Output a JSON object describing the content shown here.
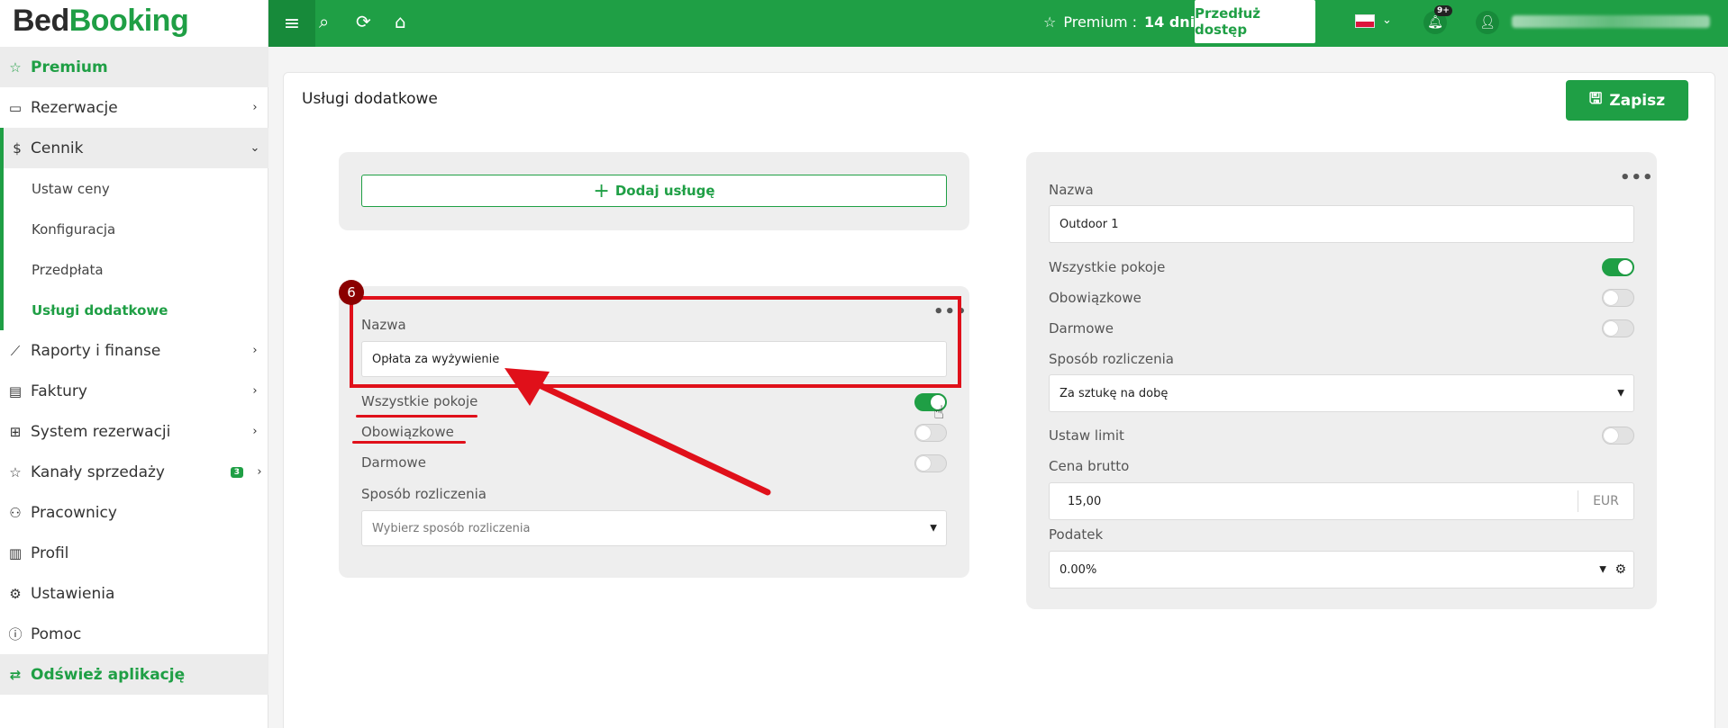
{
  "logo": {
    "part1": "Bed",
    "part2": "Booking"
  },
  "sidebar": {
    "premium": "Premium",
    "items": [
      {
        "label": "Rezerwacje"
      },
      {
        "label": "Cennik"
      },
      {
        "label": "Raporty i finanse"
      },
      {
        "label": "Faktury"
      },
      {
        "label": "System rezerwacji"
      },
      {
        "label": "Kanały sprzedaży",
        "badge": "3"
      },
      {
        "label": "Pracownicy"
      },
      {
        "label": "Profil"
      },
      {
        "label": "Ustawienia"
      },
      {
        "label": "Pomoc"
      }
    ],
    "sub": [
      "Ustaw ceny",
      "Konfiguracja",
      "Przedpłata",
      "Usługi dodatkowe"
    ],
    "refresh": "Odśwież aplikację"
  },
  "topbar": {
    "premium_label": "Premium :",
    "premium_days": "14 dni",
    "extend": "Przedłuż dostęp",
    "notif_badge": "9+"
  },
  "page": {
    "title": "Usługi dodatkowe",
    "save": "Zapisz"
  },
  "left_panel": {
    "add_service": "Dodaj usługę",
    "name_label": "Nazwa",
    "name_value": "Opłata za wyżywienie",
    "all_rooms": "Wszystkie pokoje",
    "mandatory": "Obowiązkowe",
    "free": "Darmowe",
    "billing_label": "Sposób rozliczenia",
    "billing_placeholder": "Wybierz sposób rozliczenia",
    "toggles": {
      "all_rooms": true,
      "mandatory": false,
      "free": false
    }
  },
  "right_panel": {
    "name_label": "Nazwa",
    "name_value": "Outdoor 1",
    "all_rooms": "Wszystkie pokoje",
    "mandatory": "Obowiązkowe",
    "free": "Darmowe",
    "billing_label": "Sposób rozliczenia",
    "billing_value": "Za sztukę na dobę",
    "limit_label": "Ustaw limit",
    "price_label": "Cena brutto",
    "price_value": "15,00",
    "currency": "EUR",
    "tax_label": "Podatek",
    "tax_value": "0.00%",
    "toggles": {
      "all_rooms": true,
      "mandatory": false,
      "free": false,
      "limit": false
    }
  },
  "annotation": {
    "step": "6"
  },
  "colors": {
    "brand": "#1f9f45",
    "annotation": "#e0101a"
  }
}
